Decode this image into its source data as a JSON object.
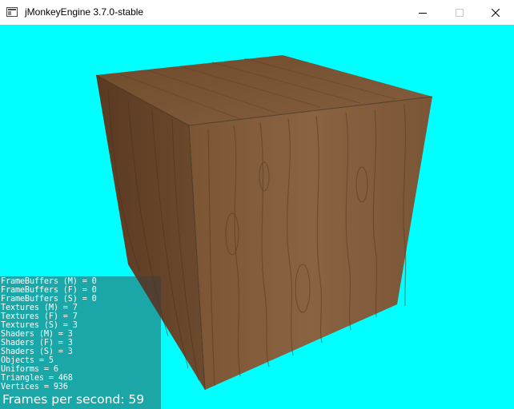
{
  "window": {
    "title": "jMonkeyEngine 3.7.0-stable",
    "app_icon": "window-app-icon",
    "controls": {
      "minimize_icon": "minimize-icon",
      "maximize_icon": "maximize-icon",
      "close_icon": "close-icon"
    }
  },
  "scene": {
    "background_color": "#00ffff",
    "object": "wooden-crate-cube",
    "wood_colors": [
      "#7a5433",
      "#6b4429",
      "#8a6443",
      "#5e3a22"
    ]
  },
  "stats": {
    "lines": [
      "FrameBuffers (M) = 0",
      "FrameBuffers (F) = 0",
      "FrameBuffers (S) = 0",
      "Textures (M) = 7",
      "Textures (F) = 7",
      "Textures (S) = 3",
      "Shaders (M) = 3",
      "Shaders (F) = 3",
      "Shaders (S) = 3",
      "Objects = 5",
      "Uniforms = 6",
      "Triangles = 468",
      "Vertices = 936"
    ],
    "fps": "Frames per second: 59"
  }
}
